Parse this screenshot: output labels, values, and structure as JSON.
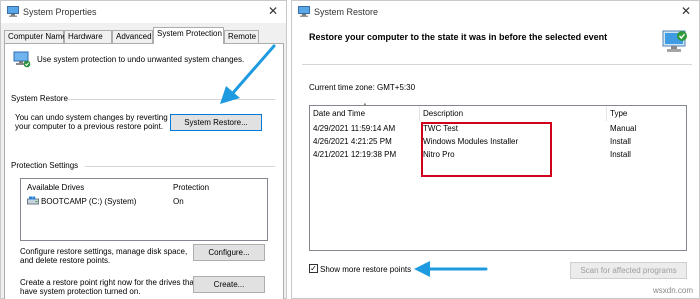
{
  "system_properties": {
    "title": "System Properties",
    "close_glyph": "✕",
    "tabs": [
      "Computer Name",
      "Hardware",
      "Advanced",
      "System Protection",
      "Remote"
    ],
    "active_tab": "System Protection",
    "intro_text": "Use system protection to undo unwanted system changes.",
    "system_restore": {
      "group_label": "System Restore",
      "desc_line1": "You can undo system changes by reverting",
      "desc_line2": "your computer to a previous restore point.",
      "button": "System Restore..."
    },
    "protection_settings": {
      "group_label": "Protection Settings",
      "columns": [
        "Available Drives",
        "Protection"
      ],
      "drives": [
        {
          "name": "BOOTCAMP (C:) (System)",
          "protection": "On",
          "icon": "drive-icon"
        }
      ],
      "configure_line1": "Configure restore settings, manage disk space,",
      "configure_line2": "and delete restore points.",
      "configure_button": "Configure...",
      "create_line1": "Create a restore point right now for the drives that",
      "create_line2": "have system protection turned on.",
      "create_button": "Create..."
    }
  },
  "system_restore_window": {
    "title": "System Restore",
    "close_glyph": "✕",
    "heading": "Restore your computer to the state it was in before the selected event",
    "timezone": "Current time zone: GMT+5:30",
    "columns": [
      "Date and Time",
      "Description",
      "Type"
    ],
    "rows": [
      {
        "date": "4/29/2021 11:59:14 AM",
        "description": "TWC Test",
        "type": "Manual"
      },
      {
        "date": "4/26/2021 4:21:25 PM",
        "description": "Windows Modules Installer",
        "type": "Install"
      },
      {
        "date": "4/21/2021 12:19:38 PM",
        "description": "Nitro Pro",
        "type": "Install"
      }
    ],
    "show_more_label": "Show more restore points",
    "show_more_checked": true,
    "checkbox_glyph": "✓",
    "scan_button": "Scan for affected programs"
  },
  "watermark": "wsxdn.com",
  "colors": {
    "annotation_arrow": "#1e9be0",
    "highlight_box": "#d0021b",
    "focus_border": "#0078d7"
  }
}
